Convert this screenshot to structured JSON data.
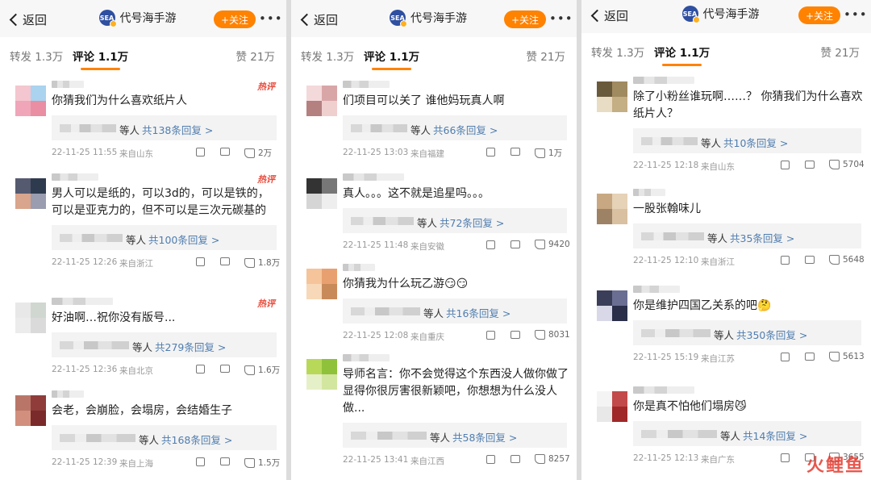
{
  "header": {
    "back_label": "返回",
    "account_name": "代号海手游",
    "logo_text": "SEA",
    "follow_label": "+关注",
    "more_icon": "more-dots-icon"
  },
  "tabs": {
    "repost": "转发 1.3万",
    "comments": "评论 1.1万",
    "likes": "赞 21万"
  },
  "colors": {
    "accent": "#ff8200",
    "link": "#507daf",
    "hot": "#e84a3a"
  },
  "panels": [
    {
      "comments": [
        {
          "hot": "热评",
          "text": [
            "你猜我们为什么喜欢纸片人"
          ],
          "reply_who": "等人",
          "reply_count": "共138条回复 >",
          "date": "22-11-25 11:55",
          "loc": "来自山东",
          "likes": "2万"
        },
        {
          "hot": "热评",
          "text": [
            "男人可以是纸的，可以3d的，可以是铁的，",
            "可以是亚克力的，但不可以是三次元碳基的"
          ],
          "reply_who": "等人",
          "reply_count": "共100条回复 >",
          "date": "22-11-25 12:26",
          "loc": "来自浙江",
          "likes": "1.8万"
        },
        {
          "hot": "热评",
          "text": [
            "好油啊…祝你没有版号..."
          ],
          "reply_who": "等人",
          "reply_count": "共279条回复 >",
          "date": "22-11-25 12:36",
          "loc": "来自北京",
          "likes": "1.6万"
        },
        {
          "hot": "",
          "text": [
            "会老，会崩脸，会塌房，会结婚生子"
          ],
          "reply_who": "等人",
          "reply_count": "共168条回复 >",
          "date": "22-11-25 12:39",
          "loc": "来自上海",
          "likes": "1.5万"
        }
      ]
    },
    {
      "comments": [
        {
          "hot": "",
          "text": [
            "们项目可以关了 谁他妈玩真人啊"
          ],
          "reply_who": "等人",
          "reply_count": "共66条回复 >",
          "date": "22-11-25 13:03",
          "loc": "来自福建",
          "likes": "1万"
        },
        {
          "hot": "",
          "text": [
            "真人。。。这不就是追星吗。。。"
          ],
          "reply_who": "等人",
          "reply_count": "共72条回复 >",
          "date": "22-11-25 11:48",
          "loc": "来自安徽",
          "likes": "9420"
        },
        {
          "hot": "",
          "text": [
            "你猜我为什么玩乙游😏😏"
          ],
          "reply_who": "等人",
          "reply_count": "共16条回复 >",
          "date": "22-11-25 12:08",
          "loc": "来自重庆",
          "likes": "8031"
        },
        {
          "hot": "",
          "text": [
            "导师名言：你不会觉得这个东西没人做你做了",
            "显得你很厉害很新颖吧，你想想为什么没人",
            "做..."
          ],
          "reply_who": "等人",
          "reply_count": "共58条回复 >",
          "date": "22-11-25 13:41",
          "loc": "来自江西",
          "likes": "8257"
        }
      ]
    },
    {
      "comments": [
        {
          "hot": "",
          "text": [
            "除了小粉丝谁玩啊……？ 你猜我们为什么喜欢",
            "纸片人？"
          ],
          "reply_who": "等人",
          "reply_count": "共10条回复 >",
          "date": "22-11-25 12:18",
          "loc": "来自山东",
          "likes": "5704"
        },
        {
          "hot": "",
          "text": [
            "一股张翰味儿"
          ],
          "reply_who": "等人",
          "reply_count": "共35条回复 >",
          "date": "22-11-25 12:10",
          "loc": "来自浙江",
          "likes": "5648"
        },
        {
          "hot": "",
          "text": [
            "你是维护四国乙关系的吧🤔"
          ],
          "reply_who": "等人",
          "reply_count": "共350条回复 >",
          "date": "22-11-25 15:19",
          "loc": "来自江苏",
          "likes": "5613"
        },
        {
          "hot": "",
          "text": [
            "你是真不怕他们塌房😼"
          ],
          "reply_who": "等人",
          "reply_count": "共14条回复 >",
          "date": "22-11-25 12:13",
          "loc": "来自广东",
          "likes": "3655"
        }
      ]
    }
  ],
  "watermark": "火鲤鱼"
}
